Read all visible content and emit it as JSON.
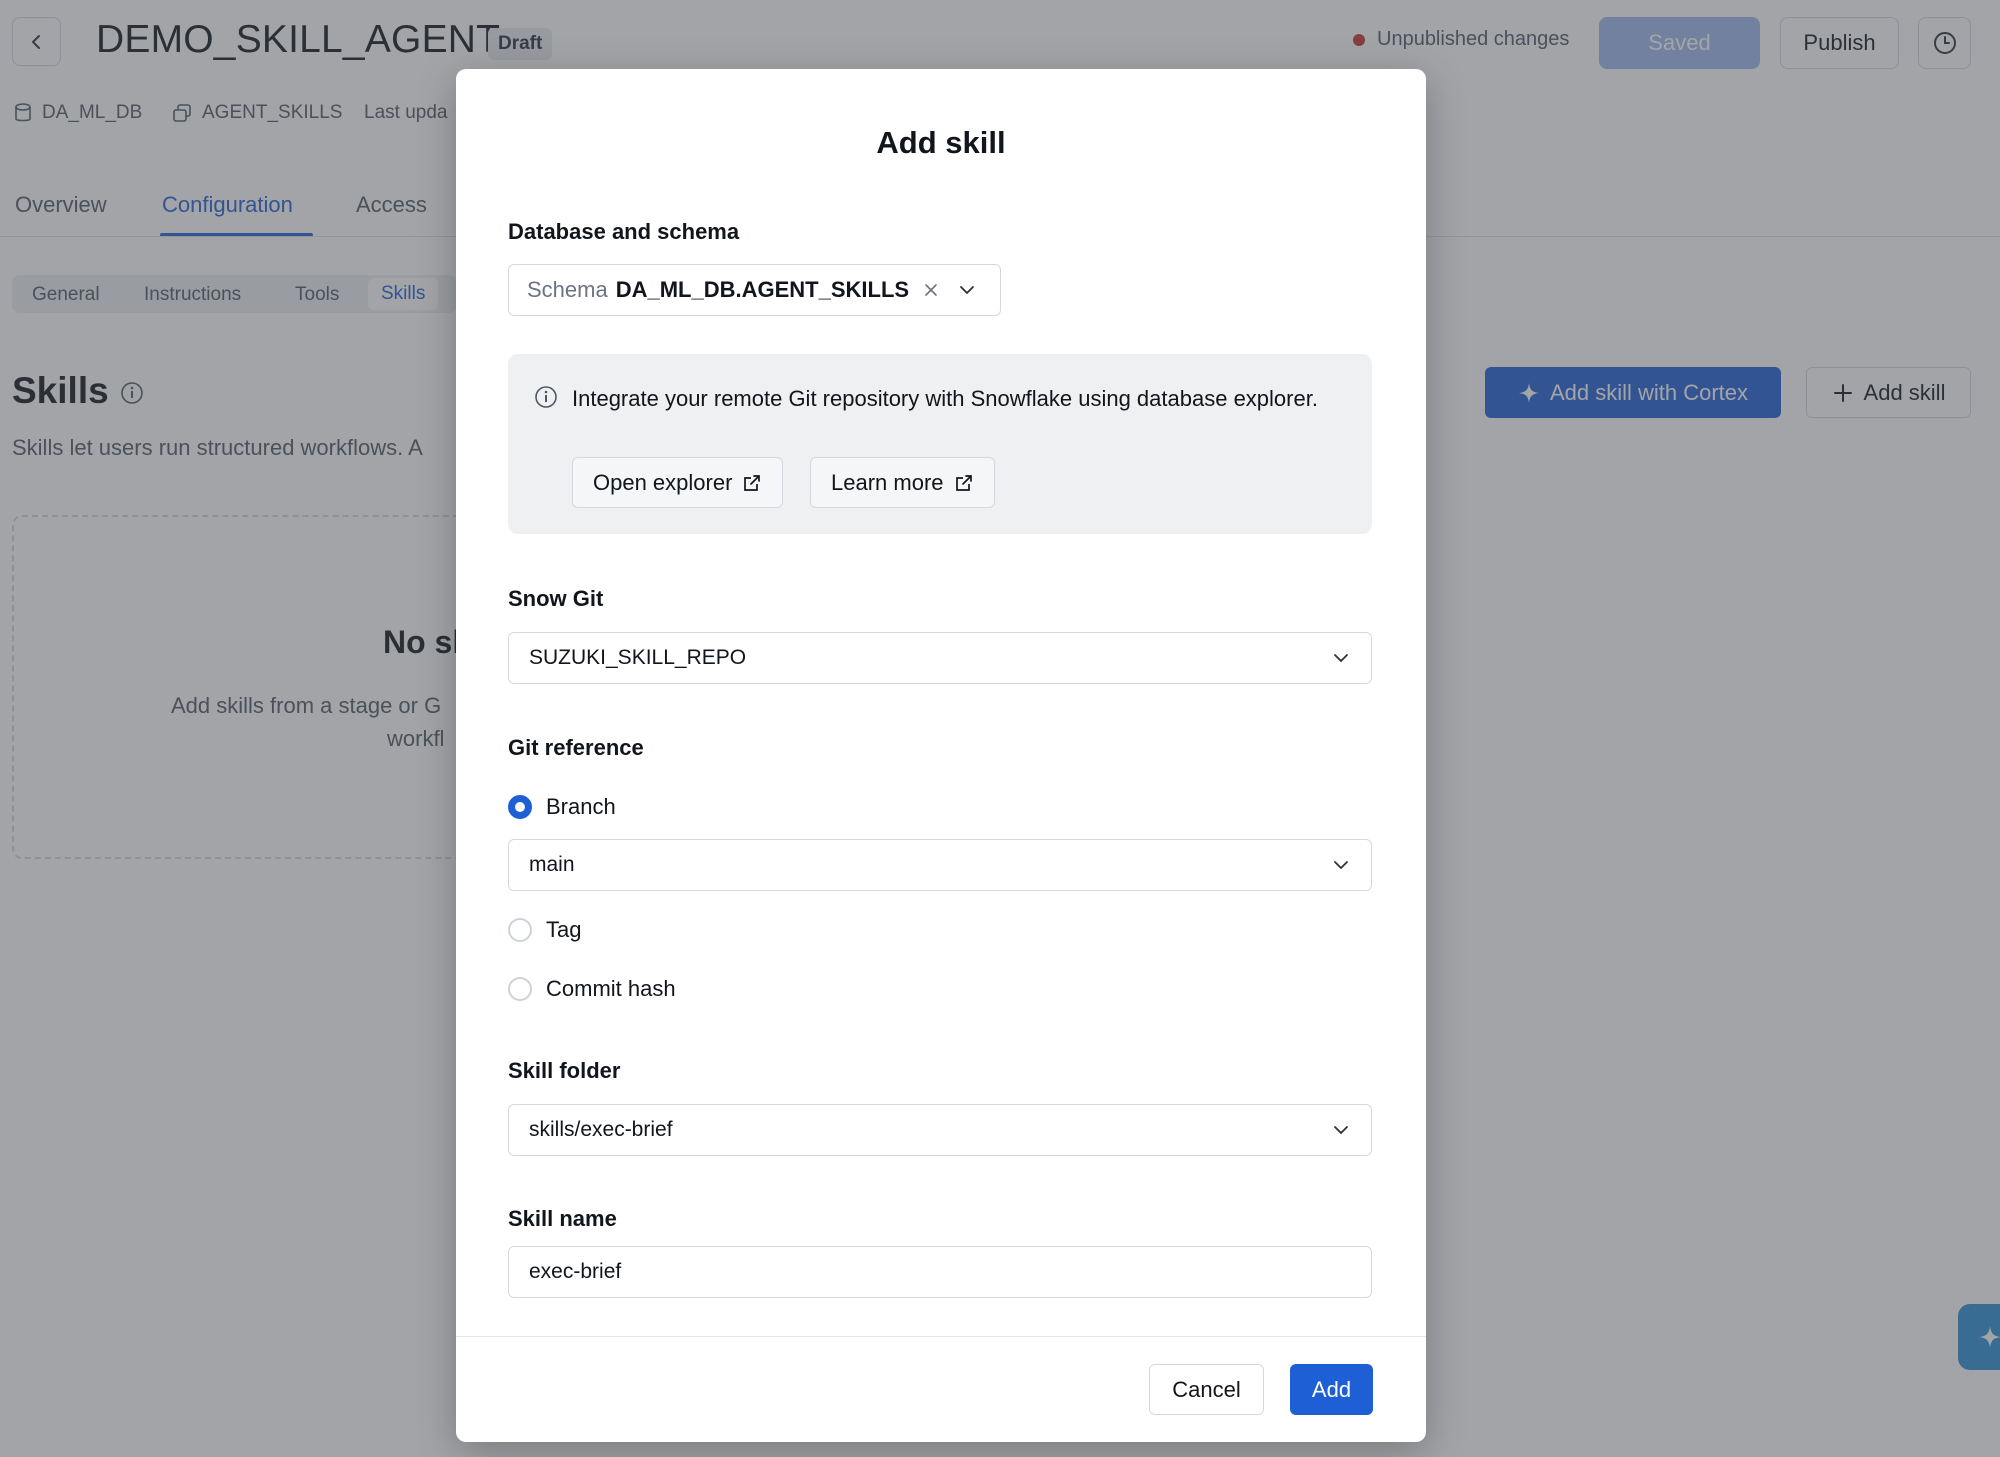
{
  "header": {
    "title": "DEMO_SKILL_AGENT",
    "badge": "Draft",
    "status": "Unpublished changes",
    "saved_label": "Saved",
    "publish_label": "Publish"
  },
  "meta": {
    "database": "DA_ML_DB",
    "schema": "AGENT_SKILLS",
    "last_updated": "Last upda"
  },
  "tabs": [
    "Overview",
    "Configuration",
    "Access"
  ],
  "subtabs": [
    "General",
    "Instructions",
    "Tools",
    "Skills"
  ],
  "skills_section": {
    "title": "Skills",
    "description": "Skills let users run structured workflows. A",
    "add_cortex_label": "Add skill with Cortex",
    "add_label": "Add skill",
    "empty_title": "No sl",
    "empty_desc_1": "Add skills from a stage or G",
    "empty_desc_2": "workfl"
  },
  "modal": {
    "title": "Add skill",
    "db_schema_label": "Database and schema",
    "schema_prefix": "Schema",
    "schema_value": "DA_ML_DB.AGENT_SKILLS",
    "info_text": "Integrate your remote Git repository with Snowflake using database explorer.",
    "open_explorer_label": "Open explorer",
    "learn_more_label": "Learn more",
    "snow_git_label": "Snow Git",
    "snow_git_value": "SUZUKI_SKILL_REPO",
    "git_ref_label": "Git reference",
    "radio_branch": "Branch",
    "branch_value": "main",
    "radio_tag": "Tag",
    "radio_commit": "Commit hash",
    "skill_folder_label": "Skill folder",
    "skill_folder_value": "skills/exec-brief",
    "skill_name_label": "Skill name",
    "skill_name_value": "exec-brief",
    "cancel_label": "Cancel",
    "add_label": "Add"
  },
  "colors": {
    "accent": "#1f5fd6",
    "status_dot": "#c7322d",
    "overlay": "rgba(70,74,80,0.50)"
  },
  "icons": [
    "chevron-left-icon",
    "history-icon",
    "database-icon",
    "schema-icon",
    "info-icon",
    "sparkle-icon",
    "plus-icon",
    "close-icon",
    "chevron-down-icon",
    "external-link-icon"
  ]
}
